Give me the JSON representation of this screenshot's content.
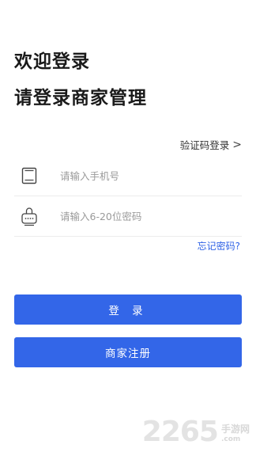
{
  "header": {
    "welcome": "欢迎登录",
    "subtitle": "请登录商家管理"
  },
  "code_login": {
    "label": "验证码登录",
    "chevron": ">"
  },
  "form": {
    "phone_placeholder": "请输入手机号",
    "password_placeholder": "请输入6-20位密码",
    "forgot_label": "忘记密码?"
  },
  "buttons": {
    "login_label": "登 录",
    "register_label": "商家注册"
  },
  "watermark": {
    "number": "2265",
    "site": "手游网",
    "domain": ".com"
  },
  "colors": {
    "primary": "#3366e8",
    "link": "#2f62e6",
    "placeholder": "#9a9a9a"
  }
}
